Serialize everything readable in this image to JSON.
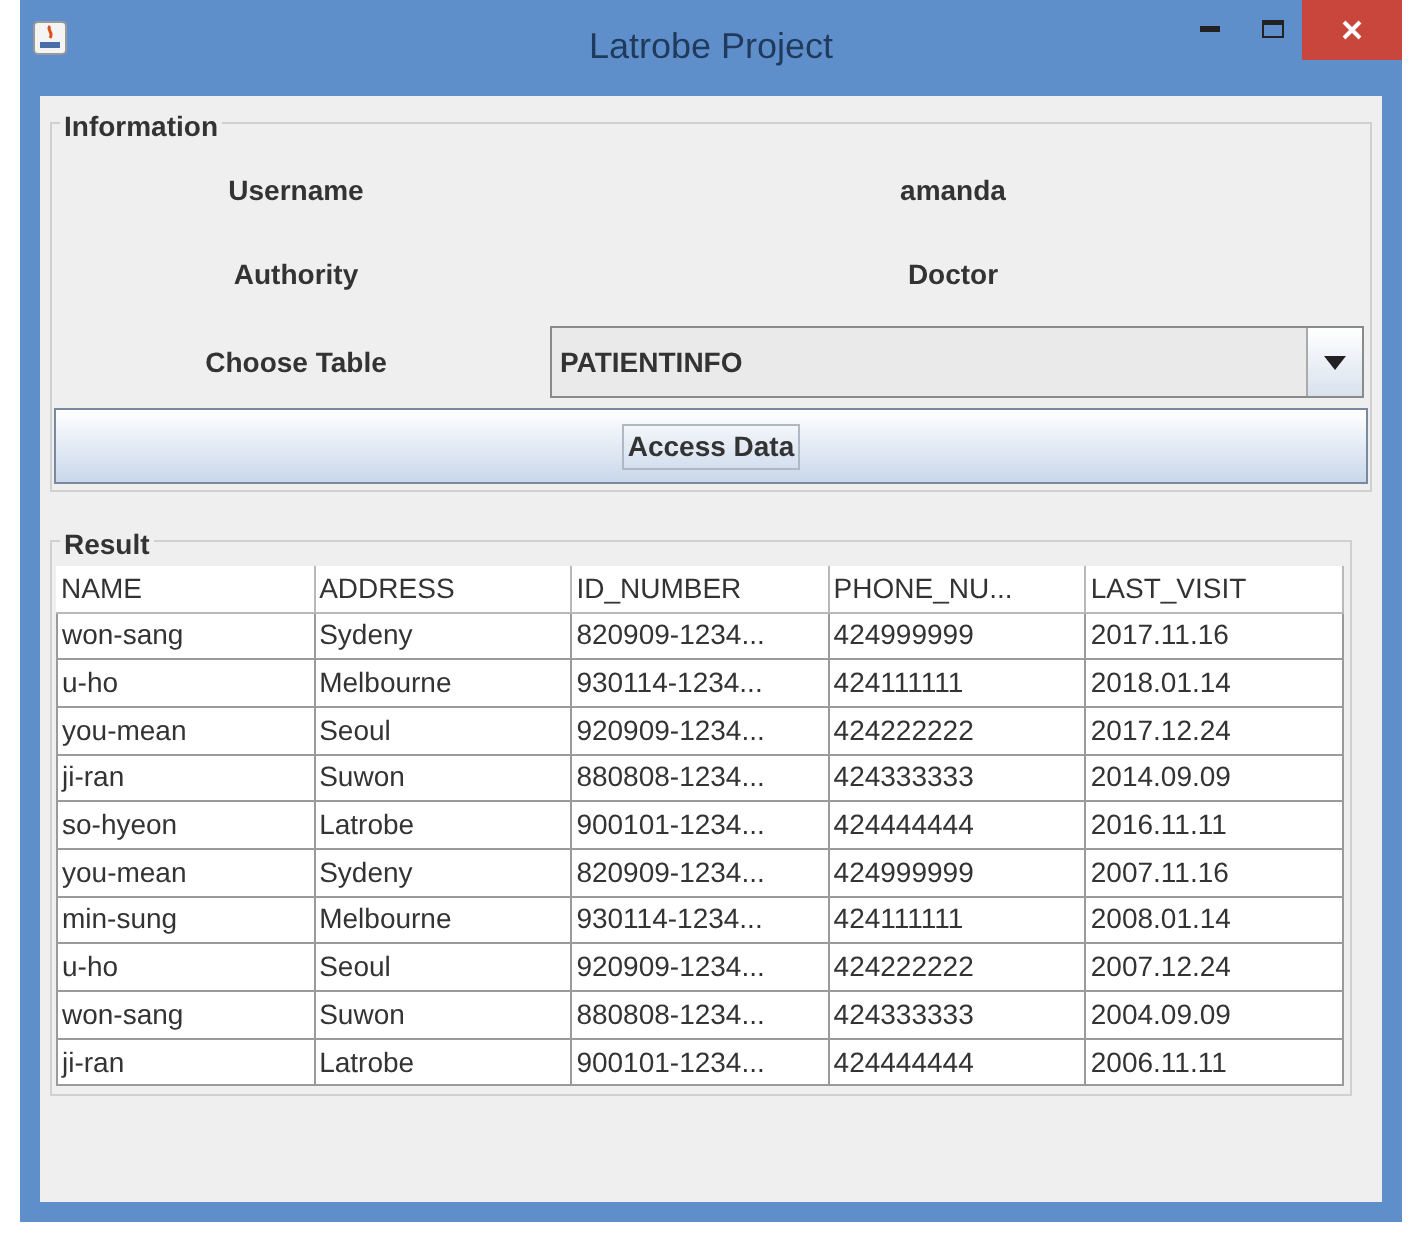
{
  "window": {
    "title": "Latrobe Project"
  },
  "information": {
    "legend": "Information",
    "fields": [
      {
        "label": "Username",
        "value": "amanda"
      },
      {
        "label": "Authority",
        "value": "Doctor"
      }
    ],
    "choose_table": {
      "label": "Choose Table",
      "value": "PATIENTINFO"
    },
    "button": "Access Data"
  },
  "result": {
    "legend": "Result",
    "columns": [
      "NAME",
      "ADDRESS",
      "ID_NUMBER",
      "PHONE_NU...",
      "LAST_VISIT"
    ],
    "rows": [
      [
        "won-sang",
        "Sydeny",
        "820909-1234...",
        "424999999",
        "2017.11.16"
      ],
      [
        "u-ho",
        "Melbourne",
        "930114-1234...",
        "424111111",
        "2018.01.14"
      ],
      [
        "you-mean",
        "Seoul",
        "920909-1234...",
        "424222222",
        "2017.12.24"
      ],
      [
        "ji-ran",
        "Suwon",
        "880808-1234...",
        "424333333",
        "2014.09.09"
      ],
      [
        "so-hyeon",
        "Latrobe",
        "900101-1234...",
        "424444444",
        "2016.11.11"
      ],
      [
        "you-mean",
        "Sydeny",
        "820909-1234...",
        "424999999",
        "2007.11.16"
      ],
      [
        "min-sung",
        "Melbourne",
        "930114-1234...",
        "424111111",
        "2008.01.14"
      ],
      [
        "u-ho",
        "Seoul",
        "920909-1234...",
        "424222222",
        "2007.12.24"
      ],
      [
        "won-sang",
        "Suwon",
        "880808-1234...",
        "424333333",
        "2004.09.09"
      ],
      [
        "ji-ran",
        "Latrobe",
        "900101-1234...",
        "424444444",
        "2006.11.11"
      ]
    ]
  }
}
